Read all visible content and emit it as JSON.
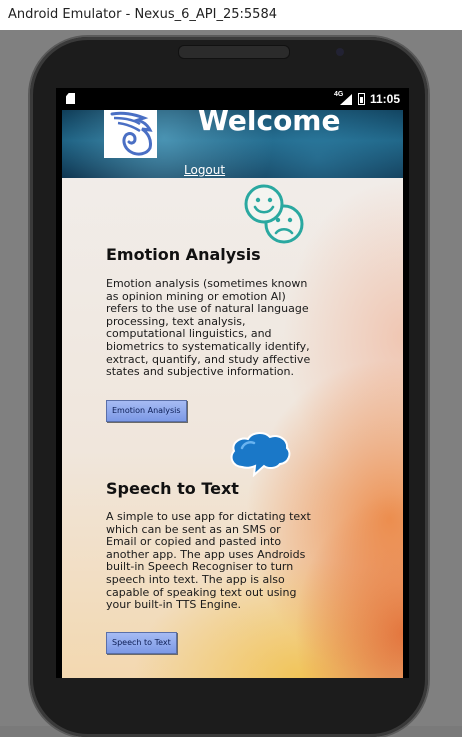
{
  "window": {
    "title": "Android Emulator - Nexus_6_API_25:5584"
  },
  "status_bar": {
    "network": "4G",
    "time": "11:05",
    "icons": [
      "sd-card-icon",
      "signal-icon",
      "battery-icon"
    ]
  },
  "banner": {
    "welcome": "Welcome",
    "logout": "Logout"
  },
  "emotion": {
    "title": "Emotion Analysis",
    "description": "Emotion analysis (sometimes known as opinion mining or emotion AI) refers to the use of natural language processing, text analysis, computational linguistics, and biometrics to systematically identify, extract, quantify, and study affective states and subjective information.",
    "button": "Emotion Analysis",
    "icon": "happy-sad-faces-icon"
  },
  "speech": {
    "title": "Speech to Text",
    "description": "A simple to use app for dictating text which can be sent as an SMS or Email or copied and pasted into another app. The app uses Androids built-in Speech Recogniser to turn speech into text. The app is also capable of speaking text out using your built-in TTS Engine.",
    "button": "Speech to Text",
    "icon": "speech-bubble-icon"
  },
  "navigation": {
    "icons": [
      "back-icon",
      "home-icon",
      "recents-icon"
    ]
  },
  "colors": {
    "banner": "#1c5f80",
    "button": "#8ea8ee",
    "icon_teal": "#2aa8a0",
    "bubble_blue": "#1a78c8"
  }
}
